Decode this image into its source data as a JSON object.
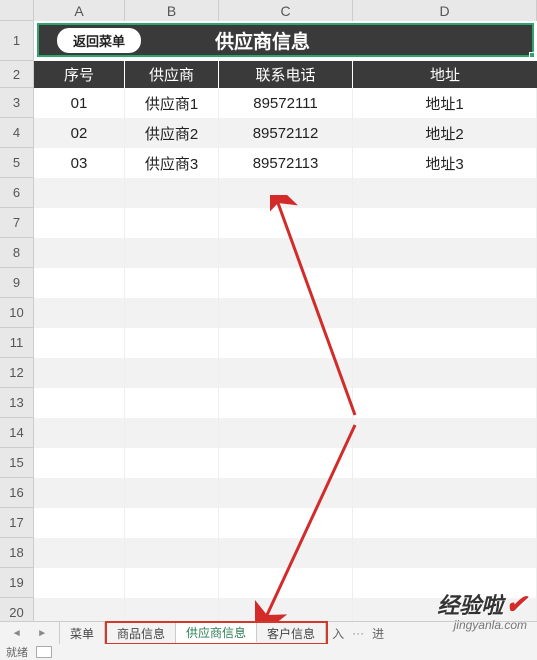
{
  "columns": [
    "A",
    "B",
    "C",
    "D"
  ],
  "row_numbers": [
    "1",
    "2",
    "3",
    "4",
    "5",
    "6",
    "7",
    "8",
    "9",
    "10",
    "11",
    "12",
    "13",
    "14",
    "15",
    "16",
    "17",
    "18",
    "19",
    "20"
  ],
  "title_bar": {
    "back_button": "返回菜单",
    "title": "供应商信息"
  },
  "table_headers": {
    "seq": "序号",
    "supplier": "供应商",
    "phone": "联系电话",
    "address": "地址"
  },
  "rows": [
    {
      "seq": "01",
      "supplier": "供应商1",
      "phone": "89572111",
      "address": "地址1"
    },
    {
      "seq": "02",
      "supplier": "供应商2",
      "phone": "89572112",
      "address": "地址2"
    },
    {
      "seq": "03",
      "supplier": "供应商3",
      "phone": "89572113",
      "address": "地址3"
    }
  ],
  "tabs": {
    "menu": "菜单",
    "product": "商品信息",
    "supplier": "供应商信息",
    "customer": "客户信息",
    "more_left": "入",
    "more_right": "进"
  },
  "status": {
    "label": "就绪"
  },
  "watermark": {
    "main": "经验啦",
    "sub": "jingyanla.com"
  }
}
